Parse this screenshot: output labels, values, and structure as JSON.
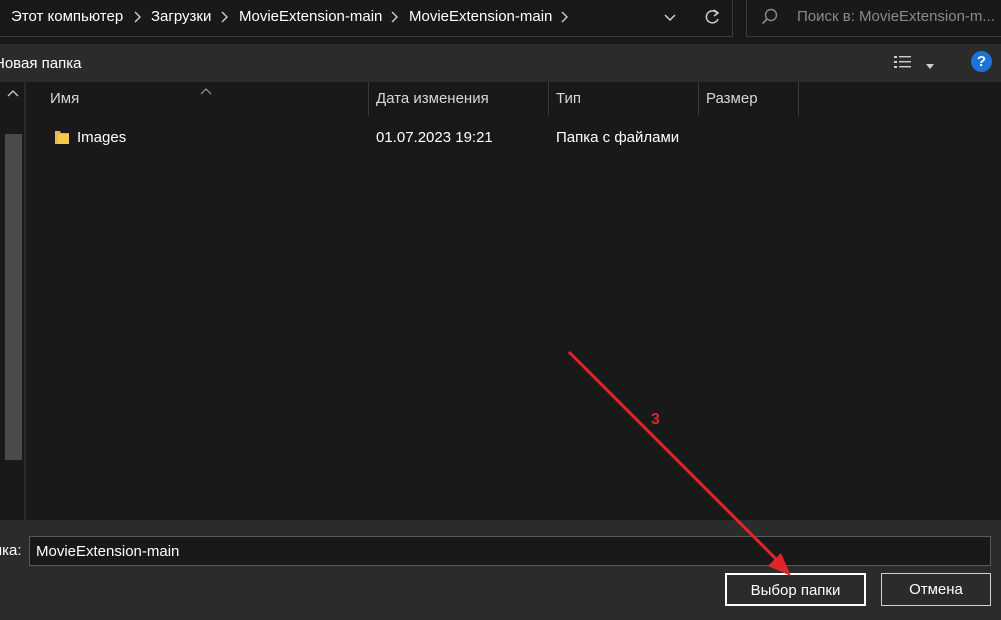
{
  "address_bar": {
    "breadcrumbs": [
      "Этот компьютер",
      "Загрузки",
      "MovieExtension-main",
      "MovieExtension-main"
    ],
    "search_placeholder": "Поиск в: MovieExtension-m..."
  },
  "toolbar": {
    "new_folder_label": "Новая папка",
    "help_label": "?"
  },
  "file_list": {
    "columns": [
      "Имя",
      "Дата изменения",
      "Тип",
      "Размер"
    ],
    "rows": [
      {
        "name": "Images",
        "date": "01.07.2023 19:21",
        "type": "Папка с файлами",
        "size": ""
      }
    ]
  },
  "bottom": {
    "folder_label": "пка:",
    "folder_value": "MovieExtension-main",
    "select_button": "Выбор папки",
    "cancel_button": "Отмена"
  },
  "annotation": {
    "step_number": "3",
    "color": "#e0252a"
  },
  "colors": {
    "window_bg": "#191919",
    "bar_bg": "#2b2b2b",
    "help_blue": "#1a73d8",
    "folder_yellow": "#f2c94c"
  }
}
